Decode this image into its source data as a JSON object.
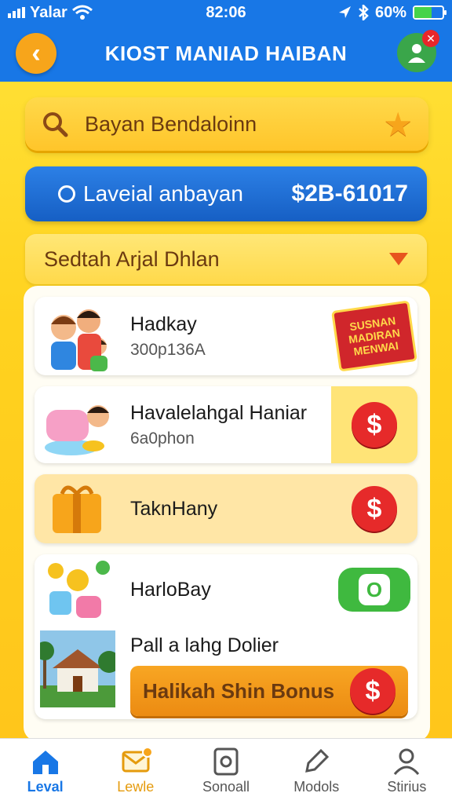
{
  "status": {
    "carrier": "Yalar",
    "time": "82:06",
    "battery": "60%",
    "battery_level": 0.6
  },
  "header": {
    "title": "KIOST MANIAD HAIBAN"
  },
  "search": {
    "text": "Bayan Bendaloinn"
  },
  "balance": {
    "label": "Laveial anbayan",
    "amount": "$2B-61017"
  },
  "dropdown": {
    "label": "Sedtah Arjal Dhlan"
  },
  "list": [
    {
      "name": "Hadkay",
      "sub": "300p136A",
      "art_text": "SUSNAN MADIRAN MENWAI"
    },
    {
      "name": "Havalelahgal Haniar",
      "sub": "6a0phon",
      "art_text": "$"
    },
    {
      "name": "TaknHany",
      "sub": "",
      "art_text": "$"
    },
    {
      "name": "HarloBay",
      "sub": "",
      "art_text": "O"
    },
    {
      "name": "Pall a lahg Dolier",
      "sub": "",
      "art_text": ""
    }
  ],
  "bonus": {
    "label": "Halikah Shin Bonus",
    "icon": "$"
  },
  "tabs": [
    {
      "label": "Leval",
      "icon": "home-icon"
    },
    {
      "label": "Lewle",
      "icon": "mail-icon"
    },
    {
      "label": "Sonoall",
      "icon": "document-icon"
    },
    {
      "label": "Modols",
      "icon": "edit-icon"
    },
    {
      "label": "Stirius",
      "icon": "user-icon"
    }
  ],
  "colors": {
    "primary_blue": "#1877e6",
    "background_yellow": "#ffd21f",
    "accent_orange": "#f7a51b",
    "accent_red": "#e62a2a"
  }
}
